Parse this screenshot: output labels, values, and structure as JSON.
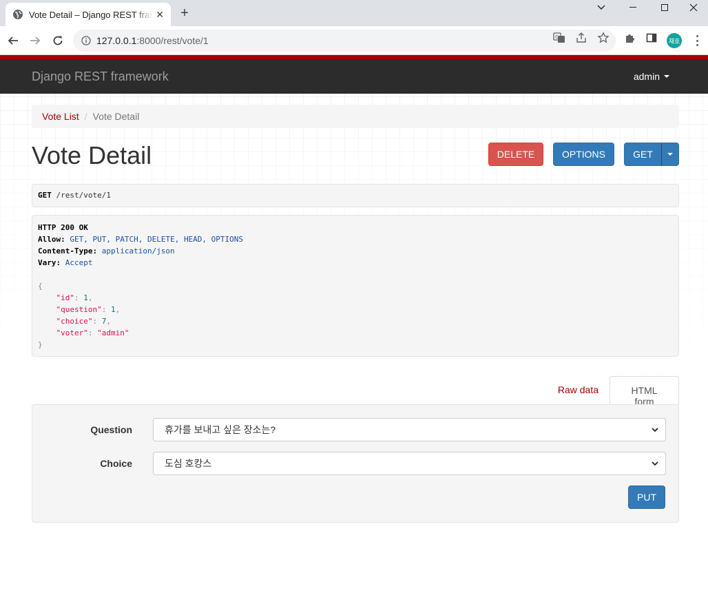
{
  "browser": {
    "tab_title": "Vote Detail – Django REST framework",
    "tab_close": "✕",
    "new_tab": "+",
    "url_host": "127.0.0.1",
    "url_path": ":8000/rest/vote/1",
    "profile_initials": "재호"
  },
  "navbar": {
    "brand": "Django REST framework",
    "user": "admin"
  },
  "breadcrumb": {
    "items": [
      "Vote List",
      "Vote Detail"
    ],
    "separator": "/"
  },
  "page": {
    "title": "Vote Detail",
    "buttons": {
      "delete": "DELETE",
      "options": "OPTIONS",
      "get": "GET"
    }
  },
  "request": {
    "method": "GET",
    "path": "/rest/vote/1"
  },
  "response": {
    "status": "HTTP 200 OK",
    "headers": [
      {
        "name": "Allow:",
        "value": "GET, PUT, PATCH, DELETE, HEAD, OPTIONS"
      },
      {
        "name": "Content-Type:",
        "value": "application/json"
      },
      {
        "name": "Vary:",
        "value": "Accept"
      }
    ],
    "body_open": "{",
    "body_close": "}",
    "fields": [
      {
        "key": "\"id\"",
        "value": "1",
        "type": "num",
        "comma": ","
      },
      {
        "key": "\"question\"",
        "value": "1",
        "type": "num",
        "comma": ","
      },
      {
        "key": "\"choice\"",
        "value": "7",
        "type": "num",
        "comma": ","
      },
      {
        "key": "\"voter\"",
        "value": "\"admin\"",
        "type": "str",
        "comma": ""
      }
    ]
  },
  "form": {
    "tabs": {
      "raw": "Raw data",
      "html": "HTML form"
    },
    "question_label": "Question",
    "question_value": "휴가를 보내고 싶은 장소는?",
    "choice_label": "Choice",
    "choice_value": "도심 호캉스",
    "submit": "PUT"
  },
  "colors": {
    "brand_red": "#a30000",
    "primary": "#337ab7",
    "danger": "#d9534f",
    "navbar": "#2c2c2c"
  }
}
